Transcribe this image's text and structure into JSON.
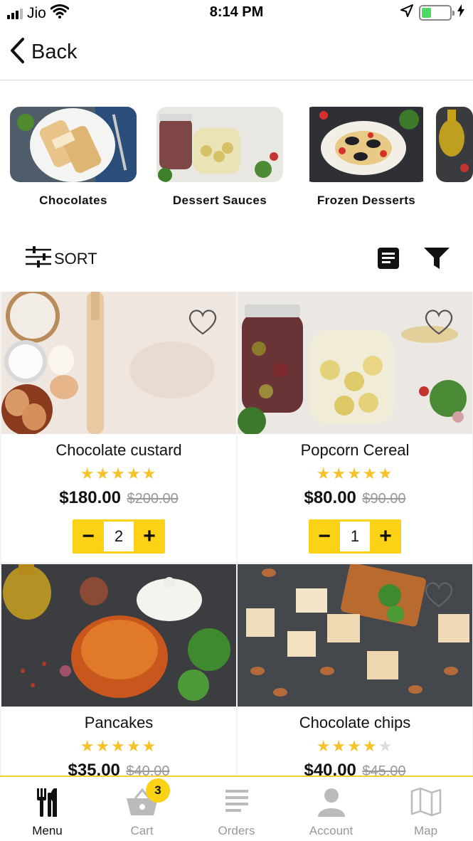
{
  "status_bar": {
    "carrier": "Jio",
    "time": "8:14 PM"
  },
  "nav": {
    "back_label": "Back"
  },
  "categories": [
    {
      "label": "Chocolates",
      "icon": "crepes-photo"
    },
    {
      "label": "Dessert Sauces",
      "icon": "pickle-jars-photo"
    },
    {
      "label": "Frozen Desserts",
      "icon": "mussel-pasta-photo"
    },
    {
      "label": "",
      "icon": "oil-bottle-photo"
    }
  ],
  "toolbar": {
    "sort_label": "SORT"
  },
  "products": [
    {
      "name": "Chocolate custard",
      "rating": 5,
      "price": "$180.00",
      "old_price": "$200.00",
      "qty": "2",
      "icon": "baking-ingredients-photo"
    },
    {
      "name": "Popcorn Cereal",
      "rating": 5,
      "price": "$80.00",
      "old_price": "$90.00",
      "qty": "1",
      "icon": "pickle-jars-photo"
    },
    {
      "name": "Pancakes",
      "rating": 5,
      "price": "$35.00",
      "old_price": "$40.00",
      "icon": "curry-pot-photo"
    },
    {
      "name": "Chocolate chips",
      "rating": 4,
      "price": "$40.00",
      "old_price": "$45.00",
      "icon": "almond-nougat-photo"
    }
  ],
  "tabs": [
    {
      "label": "Menu",
      "icon": "fork-knife-icon",
      "active": true
    },
    {
      "label": "Cart",
      "icon": "basket-icon",
      "badge": "3"
    },
    {
      "label": "Orders",
      "icon": "list-icon"
    },
    {
      "label": "Account",
      "icon": "person-icon"
    },
    {
      "label": "Map",
      "icon": "map-icon"
    }
  ],
  "colors": {
    "accent": "#fbd215",
    "star": "#f7c229",
    "muted": "#999999"
  }
}
